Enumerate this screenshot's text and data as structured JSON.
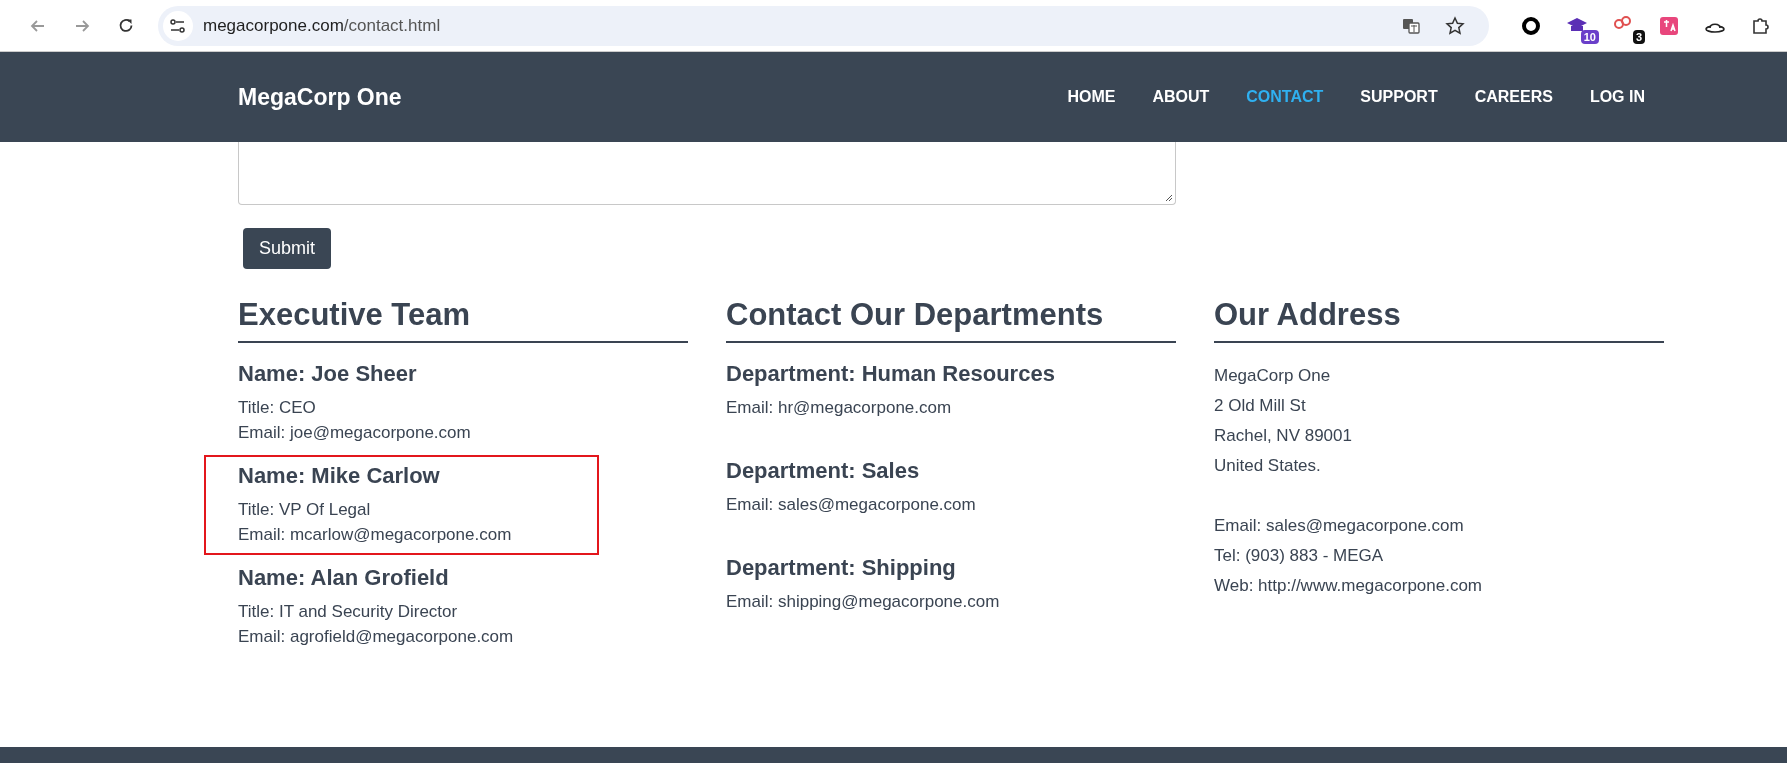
{
  "browser": {
    "url_host": "megacorpone.com",
    "url_path": "/contact.html",
    "bookmarked": false,
    "extension_badges": [
      {
        "kind": "ring"
      },
      {
        "kind": "cap",
        "badge": "10"
      },
      {
        "kind": "link",
        "badge": "3"
      },
      {
        "kind": "translate"
      },
      {
        "kind": "hat"
      },
      {
        "kind": "puzzle"
      }
    ]
  },
  "navbar": {
    "brand": "MegaCorp One",
    "links": [
      {
        "label": "HOME",
        "selected": false
      },
      {
        "label": "ABOUT",
        "selected": false
      },
      {
        "label": "CONTACT",
        "selected": true
      },
      {
        "label": "SUPPORT",
        "selected": false
      },
      {
        "label": "CAREERS",
        "selected": false
      },
      {
        "label": "LOG IN",
        "selected": false
      }
    ]
  },
  "form": {
    "submit_label": "Submit"
  },
  "executive_team": {
    "heading": "Executive Team",
    "members": [
      {
        "name": "Name: Joe Sheer",
        "title": "Title: CEO",
        "email": "Email: joe@megacorpone.com",
        "highlighted": false
      },
      {
        "name": "Name: Mike Carlow",
        "title": "Title: VP Of Legal",
        "email": "Email: mcarlow@megacorpone.com",
        "highlighted": true
      },
      {
        "name": "Name: Alan Grofield",
        "title": "Title: IT and Security Director",
        "email": "Email: agrofield@megacorpone.com",
        "highlighted": false
      }
    ]
  },
  "departments": {
    "heading": "Contact Our Departments",
    "items": [
      {
        "name": "Department: Human Resources",
        "email": "Email: hr@megacorpone.com"
      },
      {
        "name": "Department: Sales",
        "email": "Email: sales@megacorpone.com"
      },
      {
        "name": "Department: Shipping",
        "email": "Email: shipping@megacorpone.com"
      }
    ]
  },
  "address": {
    "heading": "Our Address",
    "lines": [
      "MegaCorp One",
      "2 Old Mill St",
      "Rachel, NV 89001",
      "United States."
    ],
    "contact_lines": [
      "Email: sales@megacorpone.com",
      "Tel: (903) 883 - MEGA",
      "Web: http://www.megacorpone.com"
    ]
  }
}
